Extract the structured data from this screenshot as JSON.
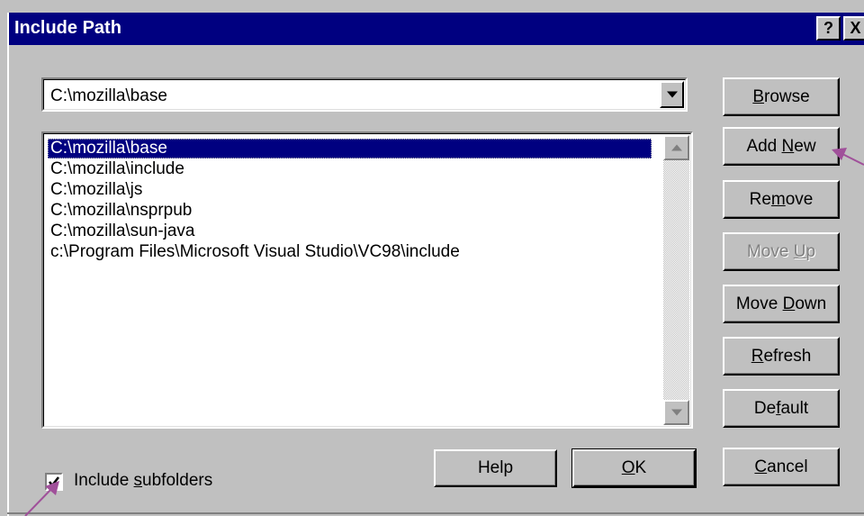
{
  "window": {
    "title": "Include Path",
    "help_button": "?",
    "close_button": "X"
  },
  "combo": {
    "value": "C:\\mozilla\\base",
    "arrow_icon": "chevron-down-icon"
  },
  "list": {
    "items": [
      "C:\\mozilla\\base",
      "C:\\mozilla\\include",
      "C:\\mozilla\\js",
      "C:\\mozilla\\nsprpub",
      "C:\\mozilla\\sun-java",
      "c:\\Program Files\\Microsoft Visual Studio\\VC98\\include"
    ],
    "selected_index": 0
  },
  "buttons": {
    "browse": {
      "pre": "",
      "key": "B",
      "post": "rowse"
    },
    "add_new": {
      "pre": "Add ",
      "key": "N",
      "post": "ew"
    },
    "remove": {
      "pre": "Re",
      "key": "m",
      "post": "ove"
    },
    "move_up": {
      "pre": "Move ",
      "key": "U",
      "post": "p",
      "disabled": true
    },
    "move_down": {
      "pre": "Move ",
      "key": "D",
      "post": "own"
    },
    "refresh": {
      "pre": "",
      "key": "R",
      "post": "efresh"
    },
    "default": {
      "pre": "De",
      "key": "f",
      "post": "ault"
    },
    "cancel": {
      "pre": "",
      "key": "C",
      "post": "ancel"
    },
    "help": {
      "label": "Help"
    },
    "ok": {
      "pre": "",
      "key": "O",
      "post": "K"
    }
  },
  "include_subfolders": {
    "checked": true,
    "pre": "Include ",
    "key": "s",
    "post": "ubfolders"
  },
  "colors": {
    "titlebar": "#000080",
    "face": "#c0c0c0",
    "selection": "#000080",
    "annotation_arrow": "#a0509a"
  }
}
